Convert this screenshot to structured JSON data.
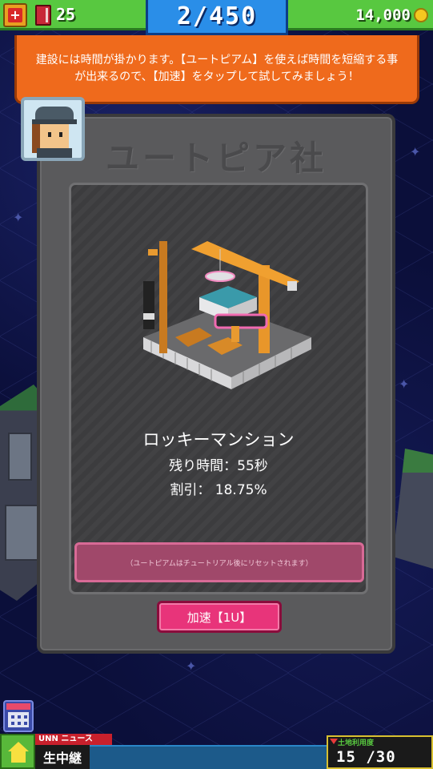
{
  "topbar": {
    "books": "25",
    "population": "2/450",
    "money": "14,000"
  },
  "tutorial": {
    "message": "建設には時間が掛かります。【ユートピアム】を使えば時間を短縮する事が出来るので、【加速】をタップして試してみましょう！"
  },
  "panel": {
    "company_name": "ユートピア社",
    "building_name": "ロッキーマンション",
    "remaining_time": "残り時間：55秒",
    "discount": "割引： 18.75%",
    "notice": "（ユートピアムはチュートリアル後にリセットされます）",
    "speed_button": "加速【1U】"
  },
  "bottombar": {
    "news_label": "UNN ニュース",
    "news_live": "生中継",
    "satisfaction_label": "土地利用度",
    "satisfaction_value": "15 /30"
  },
  "colors": {
    "accent_green": "#58c840",
    "accent_blue": "#2a8ee8",
    "tutorial_orange": "#ef6a1c",
    "button_pink": "#e8347a"
  },
  "icons": [
    "plus-icon",
    "book-icon",
    "coin-icon",
    "calendar-icon",
    "home-icon",
    "avatar"
  ]
}
